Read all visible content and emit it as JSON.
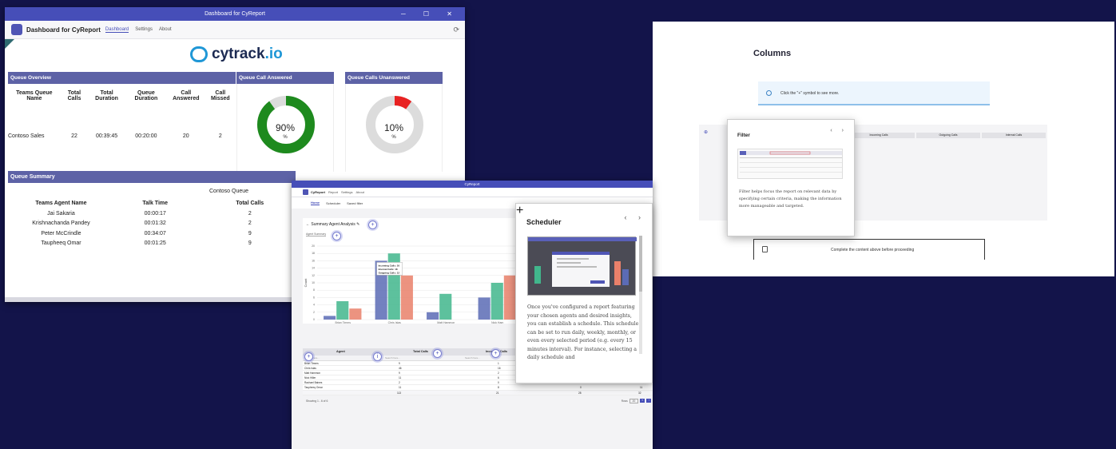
{
  "dashboard": {
    "window_title": "Dashboard for CyReport",
    "window_controls": "─ ☐ ✕",
    "app_name": "Dashboard for CyReport",
    "tabs": [
      "Dashboard",
      "Settings",
      "About"
    ],
    "refresh_icon": "refresh-icon",
    "brand": "cytrack",
    "brand_suffix": ".io",
    "queue_overview": {
      "title": "Queue Overview",
      "columns": [
        "Teams Queue Name",
        "Total Calls",
        "Total Duration",
        "Queue Duration",
        "Call Answered",
        "Call Missed"
      ],
      "rows": [
        [
          "Contoso Sales",
          "22",
          "00:39:45",
          "00:20:00",
          "20",
          "2"
        ]
      ]
    },
    "answered": {
      "title": "Queue Call Answered",
      "value": "90%",
      "unit": "%",
      "fraction": 0.9,
      "color": "#1e8a1e"
    },
    "unanswered": {
      "title": "Queue Calls Unanswered",
      "value": "10%",
      "unit": "%",
      "fraction": 0.1,
      "color": "#e82222"
    },
    "queue_summary": {
      "title": "Queue Summary",
      "queue_name": "Contoso Queue",
      "columns": [
        "Teams Agent Name",
        "Talk Time",
        "Total Calls"
      ],
      "rows": [
        [
          "Jai Sakaria",
          "00:00:17",
          "2"
        ],
        [
          "Krishnachanda Pandey",
          "00:01:32",
          "2"
        ],
        [
          "Peter McCrindle",
          "00:34:07",
          "9"
        ],
        [
          "Taupheeq Omar",
          "00:01:25",
          "9"
        ]
      ]
    }
  },
  "report": {
    "window_title": "CyReport",
    "app_name": "CyReport",
    "tabs": [
      "Report",
      "Settings",
      "About"
    ],
    "subtabs": [
      "Home",
      "Scheduler",
      "Saved filter"
    ],
    "panel_title": "Summary Agent Analysis",
    "panel_tab": "Agent Summary",
    "tooltip": [
      "Incoming Calls: 16",
      "Internal Calls: 18",
      "Outgoing Calls: 12"
    ],
    "chart_data": {
      "type": "bar",
      "categories": [
        "Brian Timms",
        "Chris Islas",
        "Matt Hammon",
        "Nick Ham"
      ],
      "series": [
        {
          "name": "Incoming Calls",
          "color": "#5b6bb5",
          "values": [
            1,
            16,
            2,
            6
          ]
        },
        {
          "name": "Internal Calls",
          "color": "#41b68c",
          "values": [
            5,
            18,
            7,
            10
          ]
        },
        {
          "name": "Outgoing Calls",
          "color": "#e9806a",
          "values": [
            3,
            12,
            0,
            12
          ]
        }
      ],
      "ylabel": "Count",
      "yticks": [
        "0",
        "2",
        "4",
        "6",
        "8",
        "10",
        "12",
        "14",
        "16",
        "18",
        "20"
      ],
      "ylim": [
        0,
        20
      ]
    },
    "table": {
      "columns": [
        "Agent",
        "Total Calls",
        "Incoming Calls"
      ],
      "search_placeholder": "Search here...",
      "rows": [
        [
          "Brian Timms",
          "9",
          "1"
        ],
        [
          "Chris Islas",
          "46",
          "16"
        ],
        [
          "Matt Hammon",
          "9",
          "2"
        ],
        [
          "Nick Hiller",
          "11",
          "6"
        ],
        [
          "Rachael Baines",
          "2",
          "0"
        ],
        [
          "Taupheeq Omar",
          "11",
          "8"
        ]
      ],
      "extra_cols": [
        [
          "",
          ""
        ],
        [
          "",
          ""
        ],
        [
          "",
          ""
        ],
        [
          "3",
          "1"
        ],
        [
          "1",
          "1"
        ],
        [
          "0",
          "11"
        ]
      ],
      "total": [
        "113",
        "21",
        "28",
        "32"
      ],
      "showing": "Showing 1 - 6 of 6",
      "rows_label": "Rows",
      "rows_value": "20"
    }
  },
  "scheduler": {
    "title": "Scheduler",
    "nav": "‹ ›",
    "text": "Once you've configured a report featuring your chosen agents and desired insights, you can establish a schedule. This schedule can be set to run daily, weekly, monthly, or even every selected period (e.g. every 15 minutes interval). For instance, selecting a daily schedule and"
  },
  "docs": {
    "title": "Columns",
    "note": "Click the \"+\" symbol to see more.",
    "grid_headers": [
      "Incoming Calls",
      "Outgoing Calls",
      "Internal Calls"
    ],
    "bottom_text": "Complete the content above before proceeding"
  },
  "filter": {
    "title": "Filter",
    "nav": "‹ ›",
    "text": "Filter helps focus the report on relevant data by specifying certain criteria, making the information more manageable and targeted."
  }
}
